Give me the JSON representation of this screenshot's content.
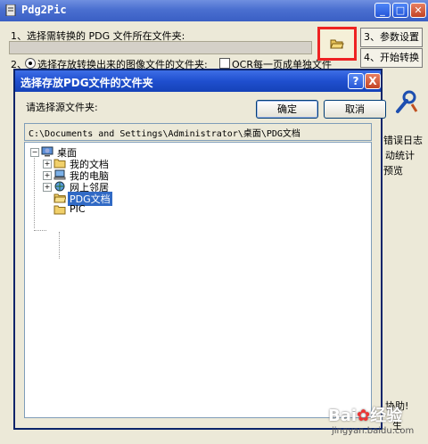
{
  "main_window": {
    "title": "Pdg2Pic",
    "step1": "1、选择需转换的 PDG 文件所在文件夹:",
    "step2": "2、",
    "radio_label": "选择存放转换出来的图像文件的文件夹:",
    "ocr_label": "OCR每一页成单独文件",
    "btn_settings": "3、参数设置",
    "btn_start": "4、开始转换",
    "right_text_1": "错误日志",
    "right_text_2": "动统计",
    "right_text_3": "预览",
    "right_text_4": "协助!",
    "right_text_5": "生"
  },
  "dialog": {
    "title": "选择存放PDG文件的文件夹",
    "help": "?",
    "close": "X",
    "prompt": "请选择源文件夹:",
    "ok": "确定",
    "cancel": "取消",
    "path": "C:\\Documents and Settings\\Administrator\\桌面\\PDG文档",
    "tree": [
      {
        "label": "桌面",
        "icon": "desktop-icon"
      },
      {
        "label": "我的文档",
        "icon": "folder-icon"
      },
      {
        "label": "我的电脑",
        "icon": "computer-icon"
      },
      {
        "label": "网上邻居",
        "icon": "network-icon"
      },
      {
        "label": "PDG文档",
        "icon": "folder-icon"
      },
      {
        "label": "PIC",
        "icon": "folder-icon"
      }
    ]
  },
  "watermark": {
    "brand": "Bai",
    "brand2": "经验",
    "url": "jingyan.baidu.com"
  },
  "colors": {
    "title_bar": "#3a5fc4",
    "selection": "#316ac5",
    "highlight_border": "#e22222"
  }
}
